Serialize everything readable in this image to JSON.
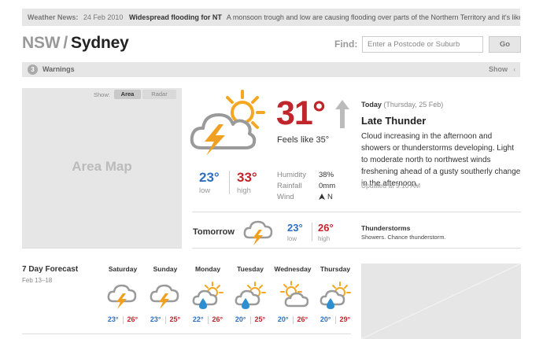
{
  "news": {
    "label": "Weather News:",
    "date": "24 Feb 2010",
    "headline": "Widespread flooding for NT",
    "text": "A monsoon trough and low are causing flooding over parts of the Northern Territory and it's likely to..."
  },
  "location": {
    "state": "NSW",
    "separator": "/",
    "city": "Sydney"
  },
  "find": {
    "label": "Find:",
    "placeholder": "Enter a Postcode or Suburb",
    "go_label": "Go"
  },
  "warnings": {
    "count": "3",
    "label": "Warnings",
    "toggle": "Show",
    "chevron": "‹"
  },
  "map": {
    "show_label": "Show:",
    "tab_area": "Area",
    "tab_radar": "Radar",
    "title": "Area Map"
  },
  "current": {
    "icon": "sun-cloud-thunder-icon",
    "temp": "31°",
    "trend_icon": "arrow-up-icon",
    "feels_like": "Feels like 35°",
    "low": "23°",
    "low_label": "low",
    "high": "33°",
    "high_label": "high",
    "humidity_label": "Humidity",
    "humidity": "38%",
    "rainfall_label": "Rainfall",
    "rainfall": "0mm",
    "wind_label": "Wind",
    "wind_dir": "N"
  },
  "today": {
    "label": "Today",
    "date": "(Thursday, 25 Feb)",
    "title": "Late Thunder",
    "description": "Cloud increasing in the afternoon and showers or thunderstorms developing. Light to moderate north to northwest winds freshening ahead of a gusty southerly change in the afternoon.",
    "updated": "Updated at 9:10 AM"
  },
  "tomorrow": {
    "label": "Tomorrow",
    "icon": "cloud-thunder-icon",
    "low": "23°",
    "low_label": "low",
    "high": "26°",
    "high_label": "high",
    "title": "Thunderstorms",
    "description": "Showers. Chance thunderstorm."
  },
  "week": {
    "title": "7 Day Forecast",
    "range": "Feb 13–18",
    "days": [
      {
        "name": "Saturday",
        "icon": "cloud-thunder-icon",
        "low": "23°",
        "high": "26°"
      },
      {
        "name": "Sunday",
        "icon": "cloud-thunder-icon",
        "low": "23°",
        "high": "25°"
      },
      {
        "name": "Monday",
        "icon": "sun-cloud-rain-icon",
        "low": "22°",
        "high": "26°"
      },
      {
        "name": "Tuesday",
        "icon": "sun-cloud-rain-icon",
        "low": "20°",
        "high": "25°"
      },
      {
        "name": "Wednesday",
        "icon": "sun-cloud-icon",
        "low": "20°",
        "high": "26°"
      },
      {
        "name": "Thursday",
        "icon": "sun-cloud-rain-icon",
        "low": "20°",
        "high": "29°"
      }
    ]
  },
  "colors": {
    "accent_red": "#c0252c",
    "accent_blue": "#2d6fc2",
    "sun": "#f5a623",
    "bolt": "#f0a020",
    "drop": "#2d8fd0",
    "panel": "#e6e6e6"
  }
}
